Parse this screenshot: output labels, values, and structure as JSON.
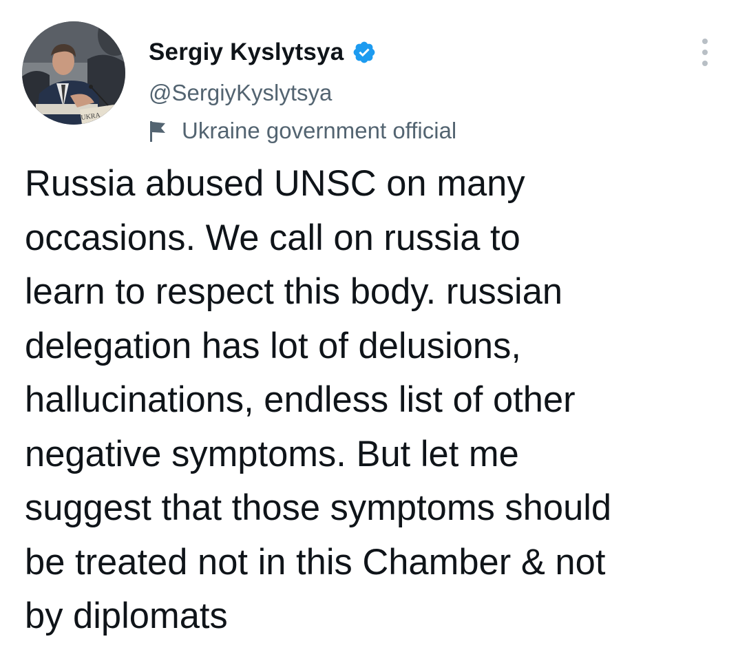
{
  "tweet": {
    "author": {
      "display_name": "Sergiy Kyslytsya",
      "handle": "@SergiyKyslytsya",
      "verified": true,
      "label": "Ukraine government official",
      "avatar_badge_text": "UKRA"
    },
    "text_lines": [
      "Russia abused UNSC on many",
      "occasions. We call on russia to",
      "learn to respect this body. russian",
      "delegation has lot of delusions,",
      "hallucinations, endless list of other",
      "negative symptoms. But let me",
      "suggest that those symptoms should",
      "be treated not in this Chamber & not",
      "by diplomats"
    ]
  },
  "icons": {
    "verified": "verified-badge-icon",
    "label": "flag-icon",
    "more": "more-options-icon"
  },
  "colors": {
    "text_primary": "#0f1419",
    "text_secondary": "#536471",
    "verified_blue": "#1d9bf0",
    "more_dots": "#b8bfc5"
  }
}
